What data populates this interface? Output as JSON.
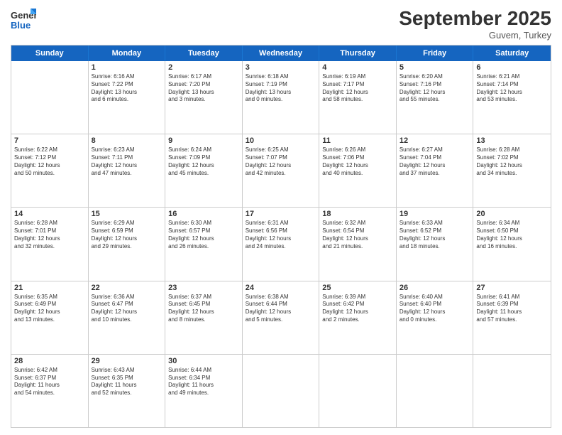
{
  "logo": {
    "line1": "General",
    "line2": "Blue"
  },
  "title": "September 2025",
  "subtitle": "Guvem, Turkey",
  "days": [
    "Sunday",
    "Monday",
    "Tuesday",
    "Wednesday",
    "Thursday",
    "Friday",
    "Saturday"
  ],
  "weeks": [
    [
      {
        "day": "",
        "info": ""
      },
      {
        "day": "1",
        "info": "Sunrise: 6:16 AM\nSunset: 7:22 PM\nDaylight: 13 hours\nand 6 minutes."
      },
      {
        "day": "2",
        "info": "Sunrise: 6:17 AM\nSunset: 7:20 PM\nDaylight: 13 hours\nand 3 minutes."
      },
      {
        "day": "3",
        "info": "Sunrise: 6:18 AM\nSunset: 7:19 PM\nDaylight: 13 hours\nand 0 minutes."
      },
      {
        "day": "4",
        "info": "Sunrise: 6:19 AM\nSunset: 7:17 PM\nDaylight: 12 hours\nand 58 minutes."
      },
      {
        "day": "5",
        "info": "Sunrise: 6:20 AM\nSunset: 7:16 PM\nDaylight: 12 hours\nand 55 minutes."
      },
      {
        "day": "6",
        "info": "Sunrise: 6:21 AM\nSunset: 7:14 PM\nDaylight: 12 hours\nand 53 minutes."
      }
    ],
    [
      {
        "day": "7",
        "info": "Sunrise: 6:22 AM\nSunset: 7:12 PM\nDaylight: 12 hours\nand 50 minutes."
      },
      {
        "day": "8",
        "info": "Sunrise: 6:23 AM\nSunset: 7:11 PM\nDaylight: 12 hours\nand 47 minutes."
      },
      {
        "day": "9",
        "info": "Sunrise: 6:24 AM\nSunset: 7:09 PM\nDaylight: 12 hours\nand 45 minutes."
      },
      {
        "day": "10",
        "info": "Sunrise: 6:25 AM\nSunset: 7:07 PM\nDaylight: 12 hours\nand 42 minutes."
      },
      {
        "day": "11",
        "info": "Sunrise: 6:26 AM\nSunset: 7:06 PM\nDaylight: 12 hours\nand 40 minutes."
      },
      {
        "day": "12",
        "info": "Sunrise: 6:27 AM\nSunset: 7:04 PM\nDaylight: 12 hours\nand 37 minutes."
      },
      {
        "day": "13",
        "info": "Sunrise: 6:28 AM\nSunset: 7:02 PM\nDaylight: 12 hours\nand 34 minutes."
      }
    ],
    [
      {
        "day": "14",
        "info": "Sunrise: 6:28 AM\nSunset: 7:01 PM\nDaylight: 12 hours\nand 32 minutes."
      },
      {
        "day": "15",
        "info": "Sunrise: 6:29 AM\nSunset: 6:59 PM\nDaylight: 12 hours\nand 29 minutes."
      },
      {
        "day": "16",
        "info": "Sunrise: 6:30 AM\nSunset: 6:57 PM\nDaylight: 12 hours\nand 26 minutes."
      },
      {
        "day": "17",
        "info": "Sunrise: 6:31 AM\nSunset: 6:56 PM\nDaylight: 12 hours\nand 24 minutes."
      },
      {
        "day": "18",
        "info": "Sunrise: 6:32 AM\nSunset: 6:54 PM\nDaylight: 12 hours\nand 21 minutes."
      },
      {
        "day": "19",
        "info": "Sunrise: 6:33 AM\nSunset: 6:52 PM\nDaylight: 12 hours\nand 18 minutes."
      },
      {
        "day": "20",
        "info": "Sunrise: 6:34 AM\nSunset: 6:50 PM\nDaylight: 12 hours\nand 16 minutes."
      }
    ],
    [
      {
        "day": "21",
        "info": "Sunrise: 6:35 AM\nSunset: 6:49 PM\nDaylight: 12 hours\nand 13 minutes."
      },
      {
        "day": "22",
        "info": "Sunrise: 6:36 AM\nSunset: 6:47 PM\nDaylight: 12 hours\nand 10 minutes."
      },
      {
        "day": "23",
        "info": "Sunrise: 6:37 AM\nSunset: 6:45 PM\nDaylight: 12 hours\nand 8 minutes."
      },
      {
        "day": "24",
        "info": "Sunrise: 6:38 AM\nSunset: 6:44 PM\nDaylight: 12 hours\nand 5 minutes."
      },
      {
        "day": "25",
        "info": "Sunrise: 6:39 AM\nSunset: 6:42 PM\nDaylight: 12 hours\nand 2 minutes."
      },
      {
        "day": "26",
        "info": "Sunrise: 6:40 AM\nSunset: 6:40 PM\nDaylight: 12 hours\nand 0 minutes."
      },
      {
        "day": "27",
        "info": "Sunrise: 6:41 AM\nSunset: 6:39 PM\nDaylight: 11 hours\nand 57 minutes."
      }
    ],
    [
      {
        "day": "28",
        "info": "Sunrise: 6:42 AM\nSunset: 6:37 PM\nDaylight: 11 hours\nand 54 minutes."
      },
      {
        "day": "29",
        "info": "Sunrise: 6:43 AM\nSunset: 6:35 PM\nDaylight: 11 hours\nand 52 minutes."
      },
      {
        "day": "30",
        "info": "Sunrise: 6:44 AM\nSunset: 6:34 PM\nDaylight: 11 hours\nand 49 minutes."
      },
      {
        "day": "",
        "info": ""
      },
      {
        "day": "",
        "info": ""
      },
      {
        "day": "",
        "info": ""
      },
      {
        "day": "",
        "info": ""
      }
    ]
  ]
}
